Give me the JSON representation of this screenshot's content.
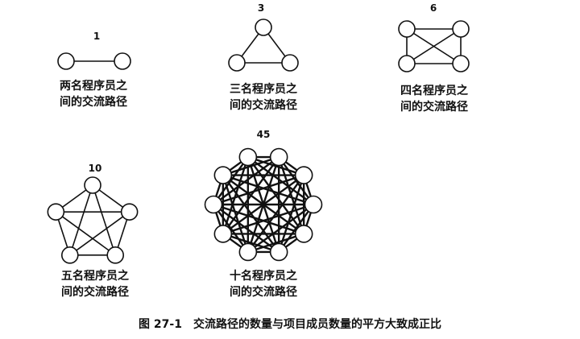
{
  "graphs": [
    {
      "count": "1",
      "nodes": 2,
      "caption_line1": "两名程序员之",
      "caption_line2": "间的交流路径"
    },
    {
      "count": "3",
      "nodes": 3,
      "caption_line1": "三名程序员之",
      "caption_line2": "间的交流路径"
    },
    {
      "count": "6",
      "nodes": 4,
      "caption_line1": "四名程序员之",
      "caption_line2": "间的交流路径"
    },
    {
      "count": "10",
      "nodes": 5,
      "caption_line1": "五名程序员之",
      "caption_line2": "间的交流路径"
    },
    {
      "count": "45",
      "nodes": 10,
      "caption_line1": "十名程序员之",
      "caption_line2": "间的交流路径"
    }
  ],
  "figure": {
    "id": "图 27-1",
    "text": "交流路径的数量与项目成员数量的平方大致成正比"
  }
}
